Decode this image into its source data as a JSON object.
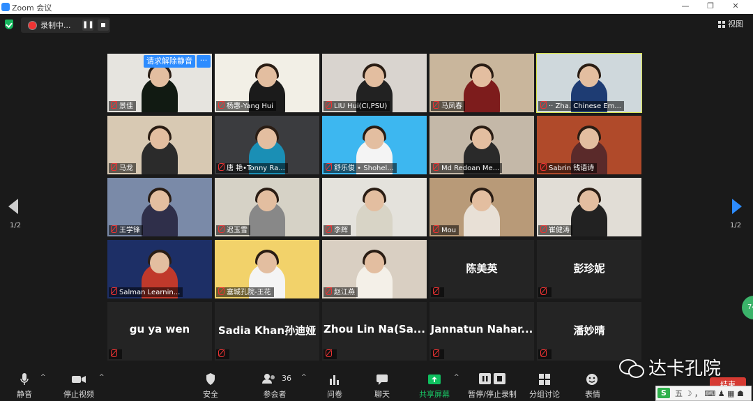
{
  "window": {
    "title": "Zoom 会议",
    "minimize": "—",
    "maximize": "❐",
    "close": "✕"
  },
  "recording": {
    "label": "录制中...",
    "pause": "❚❚"
  },
  "view": {
    "label": "视图"
  },
  "unmute_request": {
    "label": "请求解除静音",
    "more": "···"
  },
  "pagination": {
    "left": "1/2",
    "right": "1/2"
  },
  "badge": {
    "label": "74"
  },
  "participants": [
    {
      "name": "景佳",
      "type": "video"
    },
    {
      "name": "杨惠-Yang Hui",
      "type": "video"
    },
    {
      "name": "LIU Hui(CI,PSU)",
      "type": "video"
    },
    {
      "name": "马凤春",
      "type": "video"
    },
    {
      "name": "·· Zha.  Chinese Em...",
      "type": "video",
      "active": true
    },
    {
      "name": "马龙",
      "type": "video"
    },
    {
      "name": "唐 艳•Tonny Ra...",
      "type": "video"
    },
    {
      "name": "舒乐俊 • Shohel...",
      "type": "video"
    },
    {
      "name": "Md Redoan Me...",
      "type": "video"
    },
    {
      "name": "Sabrin 钱语诗",
      "type": "video"
    },
    {
      "name": "王学锋",
      "type": "video"
    },
    {
      "name": "迟玉雪",
      "type": "video"
    },
    {
      "name": "李辉",
      "type": "video"
    },
    {
      "name": "Mou",
      "type": "video"
    },
    {
      "name": "崔健涛",
      "type": "video"
    },
    {
      "name": "Salman Learnin...",
      "type": "video"
    },
    {
      "name": "塞城孔院-王花",
      "type": "video"
    },
    {
      "name": "赵江燕",
      "type": "video"
    },
    {
      "name": "陈美英",
      "type": "noVideo"
    },
    {
      "name": "彭珍妮",
      "type": "noVideo"
    },
    {
      "name": "gu ya wen",
      "type": "noVideo"
    },
    {
      "name": "Sadia  Khan孙迪娅",
      "type": "noVideo"
    },
    {
      "name": "Zhou  Lin  Na(Sa...",
      "type": "noVideo"
    },
    {
      "name": "Jannatun  Nahar...",
      "type": "noVideo"
    },
    {
      "name": "潘妙晴",
      "type": "noVideo"
    }
  ],
  "toolbar": {
    "mute": "静音",
    "stop_video": "停止视频",
    "security": "安全",
    "participants": "参会者",
    "participants_count": "36",
    "polls": "问卷",
    "chat": "聊天",
    "share_screen": "共享屏幕",
    "pause_recording": "暂停/停止录制",
    "breakout": "分组讨论",
    "reactions": "表情",
    "end": "结束"
  },
  "watermark": {
    "text": "达卡孔院"
  },
  "ime": {
    "logo": "S",
    "mode": "五 ☽ ， ⌨ ♟ ▦ ☗"
  },
  "colors": {
    "accent": "#2d8cff",
    "active_border": "#d8e34a",
    "record": "#e33333",
    "end": "#d63a32",
    "share": "#0fbf5f"
  }
}
